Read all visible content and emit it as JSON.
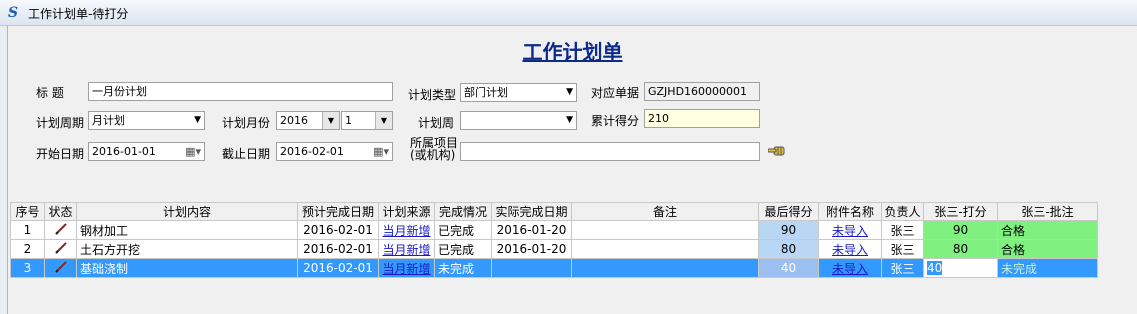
{
  "window": {
    "title": "工作计划单-待打分"
  },
  "form": {
    "title": "工作计划单",
    "title_label": "标    题",
    "title_value": "一月份计划",
    "plan_type_label": "计划类型",
    "plan_type_value": "部门计划",
    "ref_doc_label": "对应单据",
    "ref_doc_value": "GZJHD160000001",
    "plan_cycle_label": "计划周期",
    "plan_cycle_value": "月计划",
    "plan_month_label": "计划月份",
    "plan_year_value": "2016",
    "plan_month_value": "1",
    "plan_week_label": "计划周",
    "plan_week_value": "",
    "total_score_label": "累计得分",
    "total_score_value": "210",
    "start_date_label": "开始日期",
    "start_date_value": "2016-01-01",
    "end_date_label": "截止日期",
    "end_date_value": "2016-02-01",
    "project_label_1": "所属项目",
    "project_label_2": "(或机构)",
    "project_value": ""
  },
  "grid": {
    "headers": [
      "序号",
      "状态",
      "计划内容",
      "预计完成日期",
      "计划来源",
      "完成情况",
      "实际完成日期",
      "备注",
      "最后得分",
      "附件名称",
      "负责人",
      "张三-打分",
      "张三-批注"
    ],
    "rows": [
      {
        "no": "1",
        "content": "钢材加工",
        "planned": "2016-02-01",
        "source": "当月新增",
        "status": "已完成",
        "actual": "2016-01-20",
        "note": "",
        "score": "90",
        "attachment": "未导入",
        "owner": "张三",
        "rating": "90",
        "comment": "合格"
      },
      {
        "no": "2",
        "content": "土石方开挖",
        "planned": "2016-02-01",
        "source": "当月新增",
        "status": "已完成",
        "actual": "2016-01-20",
        "note": "",
        "score": "80",
        "attachment": "未导入",
        "owner": "张三",
        "rating": "80",
        "comment": "合格"
      },
      {
        "no": "3",
        "content": "基础浇制",
        "planned": "2016-02-01",
        "source": "当月新增",
        "status": "未完成",
        "actual": "",
        "note": "",
        "score": "40",
        "attachment": "未导入",
        "owner": "张三",
        "rating": "40",
        "comment": "未完成"
      }
    ]
  },
  "colors": {
    "title_blue": "#0b2a8a",
    "selected_row": "#3399ff",
    "score_blue": "#b9d7f5",
    "rating_green": "#80f080",
    "total_score_bg": "#ffffe1"
  },
  "icons": {
    "app": "app-s-icon",
    "status": "pencil-icon",
    "lookup": "hand-pointer-icon",
    "calendar": "calendar-icon",
    "dropdown": "chevron-down-icon"
  }
}
